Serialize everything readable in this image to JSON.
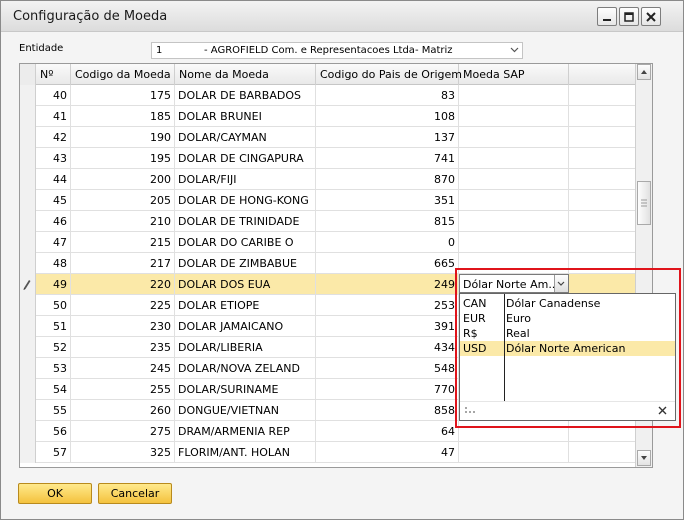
{
  "window": {
    "title": "Configuração de Moeda"
  },
  "entity": {
    "label": "Entidade",
    "number": "1",
    "name": "- AGROFIELD Com. e Representacoes Ltda- Matriz"
  },
  "grid": {
    "columns": [
      "Nº",
      "Codigo da Moeda",
      "Nome da Moeda",
      "Codigo do Pais de Origem",
      "Moeda SAP"
    ],
    "rows": [
      {
        "no": "40",
        "code": "175",
        "name": "DOLAR DE BARBADOS",
        "pais": "83",
        "sap": ""
      },
      {
        "no": "41",
        "code": "185",
        "name": "DOLAR BRUNEI",
        "pais": "108",
        "sap": ""
      },
      {
        "no": "42",
        "code": "190",
        "name": "DOLAR/CAYMAN",
        "pais": "137",
        "sap": ""
      },
      {
        "no": "43",
        "code": "195",
        "name": "DOLAR DE CINGAPURA",
        "pais": "741",
        "sap": ""
      },
      {
        "no": "44",
        "code": "200",
        "name": "DOLAR/FIJI",
        "pais": "870",
        "sap": ""
      },
      {
        "no": "45",
        "code": "205",
        "name": "DOLAR DE HONG-KONG",
        "pais": "351",
        "sap": ""
      },
      {
        "no": "46",
        "code": "210",
        "name": "DOLAR DE TRINIDADE",
        "pais": "815",
        "sap": ""
      },
      {
        "no": "47",
        "code": "215",
        "name": "DOLAR DO CARIBE O",
        "pais": "0",
        "sap": ""
      },
      {
        "no": "48",
        "code": "217",
        "name": "DOLAR DE ZIMBABUE",
        "pais": "665",
        "sap": ""
      },
      {
        "no": "49",
        "code": "220",
        "name": "DOLAR DOS EUA",
        "pais": "249",
        "sap": "Dólar Norte Am..."
      },
      {
        "no": "50",
        "code": "225",
        "name": "DOLAR ETIOPE",
        "pais": "253",
        "sap": ""
      },
      {
        "no": "51",
        "code": "230",
        "name": "DOLAR JAMAICANO",
        "pais": "391",
        "sap": ""
      },
      {
        "no": "52",
        "code": "235",
        "name": "DOLAR/LIBERIA",
        "pais": "434",
        "sap": ""
      },
      {
        "no": "53",
        "code": "245",
        "name": "DOLAR/NOVA ZELAND",
        "pais": "548",
        "sap": ""
      },
      {
        "no": "54",
        "code": "255",
        "name": "DOLAR/SURINAME",
        "pais": "770",
        "sap": ""
      },
      {
        "no": "55",
        "code": "260",
        "name": "DONGUE/VIETNAN",
        "pais": "858",
        "sap": ""
      },
      {
        "no": "56",
        "code": "275",
        "name": "DRAM/ARMENIA REP",
        "pais": "64",
        "sap": ""
      },
      {
        "no": "57",
        "code": "325",
        "name": "FLORIM/ANT. HOLAN",
        "pais": "47",
        "sap": ""
      }
    ]
  },
  "dropdown": {
    "selected": "Dólar Norte Am...",
    "options": [
      {
        "code": "CAN",
        "desc": "Dólar Canadense"
      },
      {
        "code": "EUR",
        "desc": "Euro"
      },
      {
        "code": "R$",
        "desc": "Real"
      },
      {
        "code": "USD",
        "desc": "Dólar Norte American"
      }
    ],
    "highlighted_index": 3
  },
  "buttons": {
    "ok": "OK",
    "cancel": "Cancelar"
  },
  "colors": {
    "selected_row": "#fbe9a8",
    "button_yellow": "#f4c23e",
    "annotation_red": "#e0141b"
  }
}
